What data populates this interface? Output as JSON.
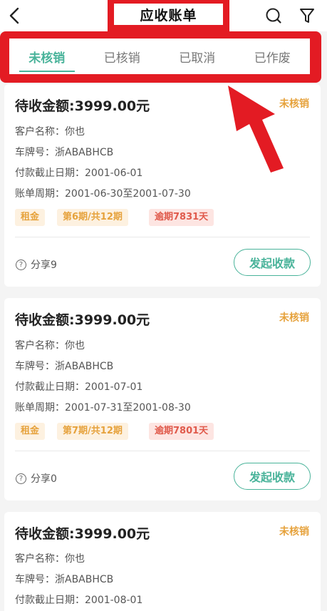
{
  "header": {
    "title": "应收账单",
    "back_icon": "chevron-left-icon",
    "search_icon": "search-icon",
    "filter_icon": "filter-icon"
  },
  "tabs": [
    {
      "label": "未核销",
      "active": true
    },
    {
      "label": "已核销",
      "active": false
    },
    {
      "label": "已取消",
      "active": false
    },
    {
      "label": "已作废",
      "active": false
    }
  ],
  "colors": {
    "accent": "#49b39a",
    "annotation": "#e31b23",
    "pending": "#e6a23c",
    "overdue": "#e05a4c"
  },
  "bills": [
    {
      "amount": "待收金额:3999.00元",
      "status": "未核销",
      "customer": "客户名称：你也",
      "plate": "车牌号：浙ABABHCB",
      "due_date": "付款截止日期：2001-06-01",
      "period": "账单周期：2001-06-30至2001-07-30",
      "tags": [
        "租金",
        "第6期/共12期",
        "逾期7831天"
      ],
      "share": "分享9",
      "action": "发起收款"
    },
    {
      "amount": "待收金额:3999.00元",
      "status": "未核销",
      "customer": "客户名称：你也",
      "plate": "车牌号：浙ABABHCB",
      "due_date": "付款截止日期：2001-07-01",
      "period": "账单周期：2001-07-31至2001-08-30",
      "tags": [
        "租金",
        "第7期/共12期",
        "逾期7801天"
      ],
      "share": "分享0",
      "action": "发起收款"
    },
    {
      "amount": "待收金额:3999.00元",
      "status": "未核销",
      "customer": "客户名称：你也",
      "plate": "车牌号：浙ABABHCB",
      "due_date": "付款截止日期：2001-08-01"
    }
  ]
}
